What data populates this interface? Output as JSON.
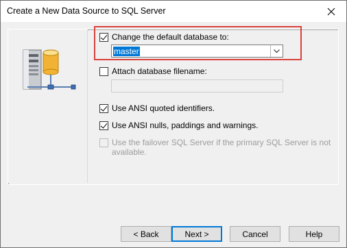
{
  "window": {
    "title": "Create a New Data Source to SQL Server"
  },
  "options": {
    "change_default_db": {
      "label": "Change the default database to:",
      "checked": true
    },
    "database_value": "master",
    "attach_db": {
      "label": "Attach database filename:",
      "checked": false,
      "value": ""
    },
    "ansi_quoted": {
      "label": "Use ANSI quoted identifiers.",
      "checked": true
    },
    "ansi_nulls": {
      "label": "Use ANSI nulls, paddings and warnings.",
      "checked": true
    },
    "failover": {
      "label_line1": "Use the failover SQL Server if the primary SQL Server is not",
      "label_line2": "available.",
      "checked": false,
      "enabled": false
    }
  },
  "buttons": {
    "back": "< Back",
    "next": "Next >",
    "cancel": "Cancel",
    "help": "Help"
  },
  "colors": {
    "highlight": "#d9403a",
    "selection": "#0078d7",
    "db_gold": "#f2b233"
  },
  "icons": {
    "close": "close-icon",
    "dropdown": "chevron-down-icon",
    "illustration": "server-database-icon"
  }
}
